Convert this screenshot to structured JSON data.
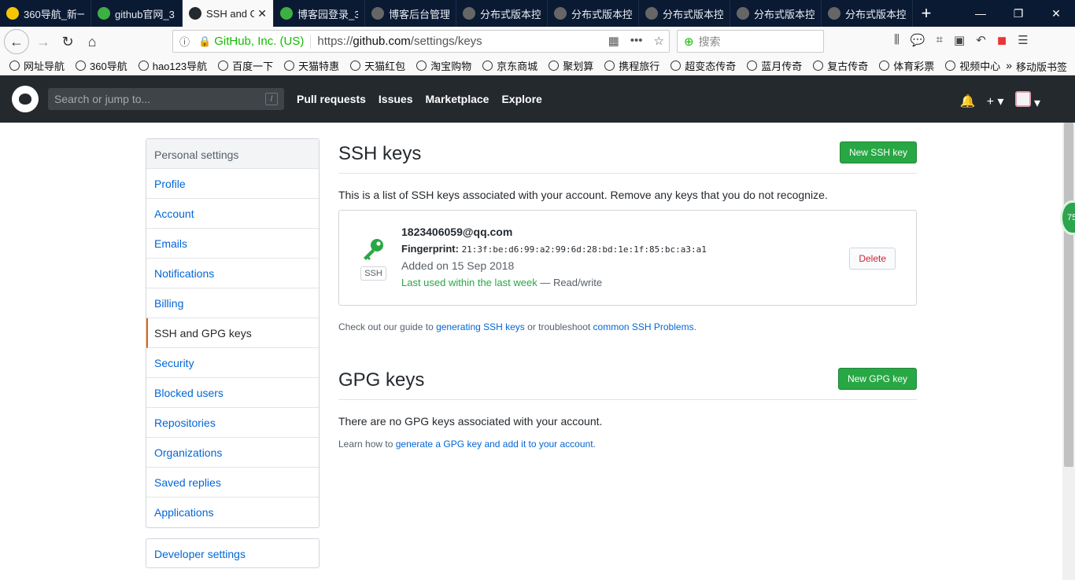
{
  "browser": {
    "tabs": [
      {
        "label": "360导航_新一",
        "color": "#f7c600",
        "active": false
      },
      {
        "label": "github官网_3",
        "color": "#3cb043",
        "active": false
      },
      {
        "label": "SSH and G",
        "color": "#24292e",
        "active": true
      },
      {
        "label": "博客园登录_3",
        "color": "#3cb043",
        "active": false
      },
      {
        "label": "博客后台管理",
        "color": "#666666",
        "active": false
      },
      {
        "label": "分布式版本控",
        "color": "#666666",
        "active": false
      },
      {
        "label": "分布式版本控",
        "color": "#666666",
        "active": false
      },
      {
        "label": "分布式版本控",
        "color": "#666666",
        "active": false
      },
      {
        "label": "分布式版本控",
        "color": "#666666",
        "active": false
      },
      {
        "label": "分布式版本控",
        "color": "#666666",
        "active": false
      }
    ],
    "url": {
      "org": "GitHub, Inc. (US)",
      "prefix": "https://",
      "domain": "github.com",
      "path": "/settings/keys"
    },
    "search_placeholder": "搜索",
    "bookmarks": [
      "网址导航",
      "360导航",
      "hao123导航",
      "百度一下",
      "天猫特惠",
      "天猫红包",
      "淘宝购物",
      "京东商城",
      "聚划算",
      "携程旅行",
      "超变态传奇",
      "蓝月传奇",
      "复古传奇",
      "体育彩票",
      "视频中心"
    ],
    "bookmarks_more": "»",
    "mobile_bookmarks": "移动版书签",
    "side_badge": "75"
  },
  "github": {
    "search_placeholder": "Search or jump to...",
    "search_shortcut": "/",
    "nav": [
      "Pull requests",
      "Issues",
      "Marketplace",
      "Explore"
    ]
  },
  "sidebar": {
    "header": "Personal settings",
    "items": [
      "Profile",
      "Account",
      "Emails",
      "Notifications",
      "Billing",
      "SSH and GPG keys",
      "Security",
      "Blocked users",
      "Repositories",
      "Organizations",
      "Saved replies",
      "Applications"
    ],
    "selected": "SSH and GPG keys",
    "developer": "Developer settings"
  },
  "ssh": {
    "title": "SSH keys",
    "new_button": "New SSH key",
    "description": "This is a list of SSH keys associated with your account. Remove any keys that you do not recognize.",
    "key": {
      "title": "1823406059@qq.com",
      "fingerprint_label": "Fingerprint:",
      "fingerprint": "21:3f:be:d6:99:a2:99:6d:28:bd:1e:1f:85:bc:a3:a1",
      "added": "Added on 15 Sep 2018",
      "last_used": "Last used within the last week",
      "access": " — Read/write",
      "tag": "SSH",
      "delete_button": "Delete"
    },
    "note_prefix": "Check out our guide to ",
    "note_link1": "generating SSH keys",
    "note_mid": " or troubleshoot ",
    "note_link2": "common SSH Problems",
    "note_suffix": "."
  },
  "gpg": {
    "title": "GPG keys",
    "new_button": "New GPG key",
    "description": "There are no GPG keys associated with your account.",
    "note_prefix": "Learn how to ",
    "note_link": "generate a GPG key and add it to your account",
    "note_suffix": "."
  }
}
